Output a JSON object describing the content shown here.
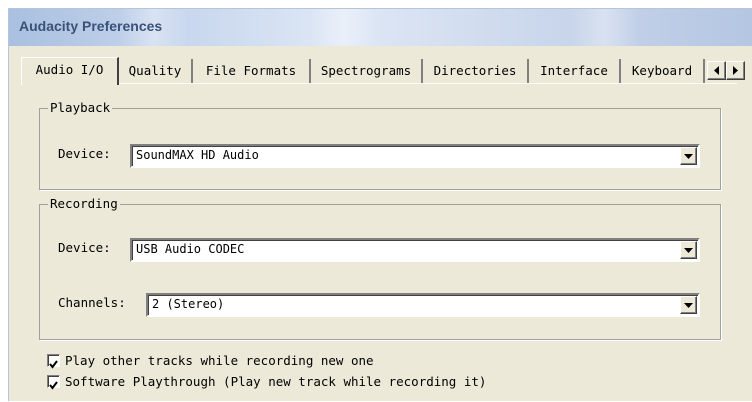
{
  "window": {
    "title": "Audacity Preferences"
  },
  "tabs": [
    {
      "label": "Audio I/O",
      "active": true
    },
    {
      "label": "Quality",
      "active": false
    },
    {
      "label": "File Formats",
      "active": false
    },
    {
      "label": "Spectrograms",
      "active": false
    },
    {
      "label": "Directories",
      "active": false
    },
    {
      "label": "Interface",
      "active": false
    },
    {
      "label": "Keyboard",
      "active": false
    }
  ],
  "tab_scroll": {
    "left_icon": "arrow-left-icon",
    "right_icon": "arrow-right-icon"
  },
  "playback": {
    "legend": "Playback",
    "device_label": "Device:",
    "device_value": "SoundMAX HD Audio"
  },
  "recording": {
    "legend": "Recording",
    "device_label": "Device:",
    "device_value": "USB Audio CODEC",
    "channels_label": "Channels:",
    "channels_value": "2 (Stereo)"
  },
  "options": [
    {
      "label": "Play other tracks while recording new one",
      "checked": true
    },
    {
      "label": "Software Playthrough (Play new track while recording it)",
      "checked": true
    }
  ],
  "colors": {
    "dialog_bg": "#ece9d8",
    "title_text": "#3a5279",
    "titlebar": "#c4d4ec"
  }
}
